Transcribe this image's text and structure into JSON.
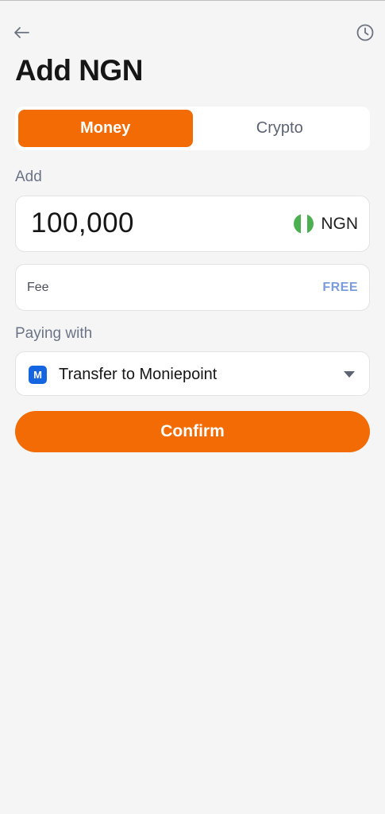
{
  "header": {
    "back_icon": "arrow-left-icon",
    "history_icon": "clock-icon",
    "title": "Add NGN"
  },
  "tabs": [
    {
      "label": "Money",
      "active": true
    },
    {
      "label": "Crypto",
      "active": false
    }
  ],
  "amount": {
    "label": "Add",
    "value": "100,000",
    "currency": "NGN",
    "flag_icon": "nigeria-flag-icon",
    "flag_colors": [
      "#4caf50",
      "#ffffff",
      "#4caf50"
    ]
  },
  "fee": {
    "label": "Fee",
    "value": "FREE"
  },
  "payment": {
    "label": "Paying with",
    "method_logo_letter": "M",
    "method": "Transfer to Moniepoint",
    "dropdown_icon": "caret-down-icon"
  },
  "confirm_label": "Confirm",
  "colors": {
    "accent": "#f26b05",
    "background": "#f5f5f5",
    "card": "#ffffff",
    "fee_free": "#7a9bdc",
    "moniepoint_blue": "#1565e0"
  }
}
